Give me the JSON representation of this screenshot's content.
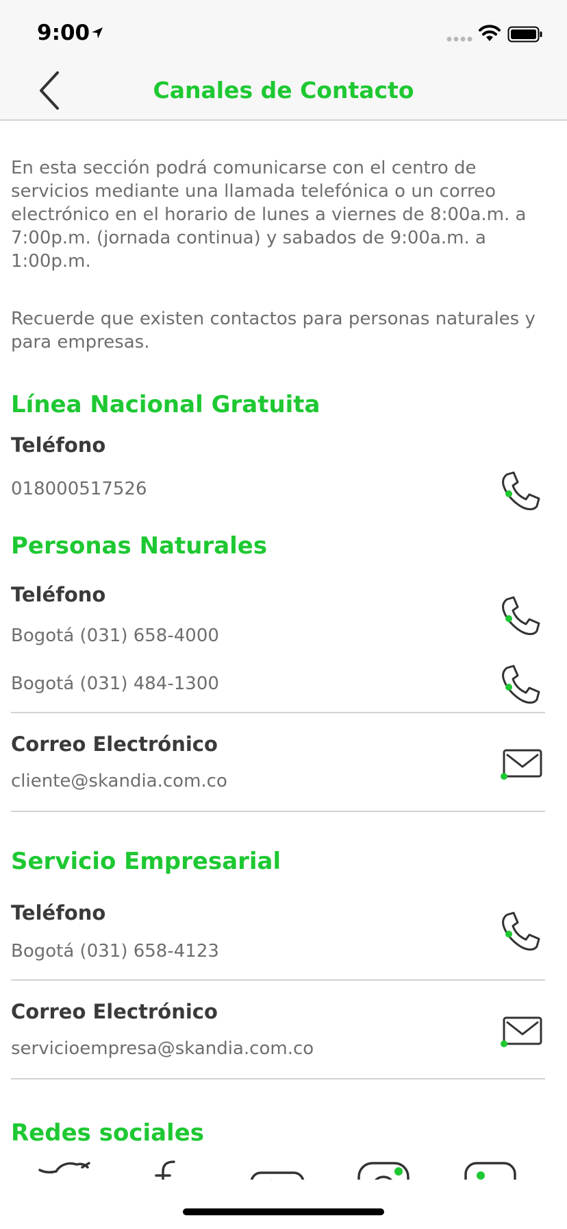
{
  "status_bar": {
    "time": "9:00"
  },
  "header": {
    "title": "Canales de Contacto",
    "back_icon": "chevron-left-icon"
  },
  "intro": {
    "paragraph1": "En esta sección podrá comunicarse con el centro de servicios mediante una llamada telefónica o un correo electrónico en el horario de lunes a viernes de 8:00a.m. a 7:00p.m. (jornada continua) y sabados de 9:00a.m. a 1:00p.m.",
    "paragraph2": "Recuerde que existen contactos para personas naturales y para empresas."
  },
  "linea_nacional": {
    "title": "Línea Nacional Gratuita",
    "phone_label": "Teléfono",
    "phone": "018000517526"
  },
  "personas_naturales": {
    "title": "Personas Naturales",
    "phone_label": "Teléfono",
    "phones": [
      "Bogotá (031) 658-4000",
      "Bogotá (031) 484-1300"
    ],
    "email_label": "Correo Electrónico",
    "email": "cliente@skandia.com.co"
  },
  "servicio_empresarial": {
    "title": "Servicio Empresarial",
    "phone_label": "Teléfono",
    "phone": "Bogotá (031) 658-4123",
    "email_label": "Correo Electrónico",
    "email": "servicioempresa@skandia.com.co"
  },
  "redes_sociales": {
    "title": "Redes sociales",
    "icons": [
      "twitter-icon",
      "facebook-icon",
      "youtube-icon",
      "instagram-icon",
      "flickr-icon"
    ]
  },
  "colors": {
    "accent": "#1ec832",
    "text_dark": "#3a3a3a",
    "text_muted": "#6e6e6e",
    "divider": "#d2d2d2"
  }
}
